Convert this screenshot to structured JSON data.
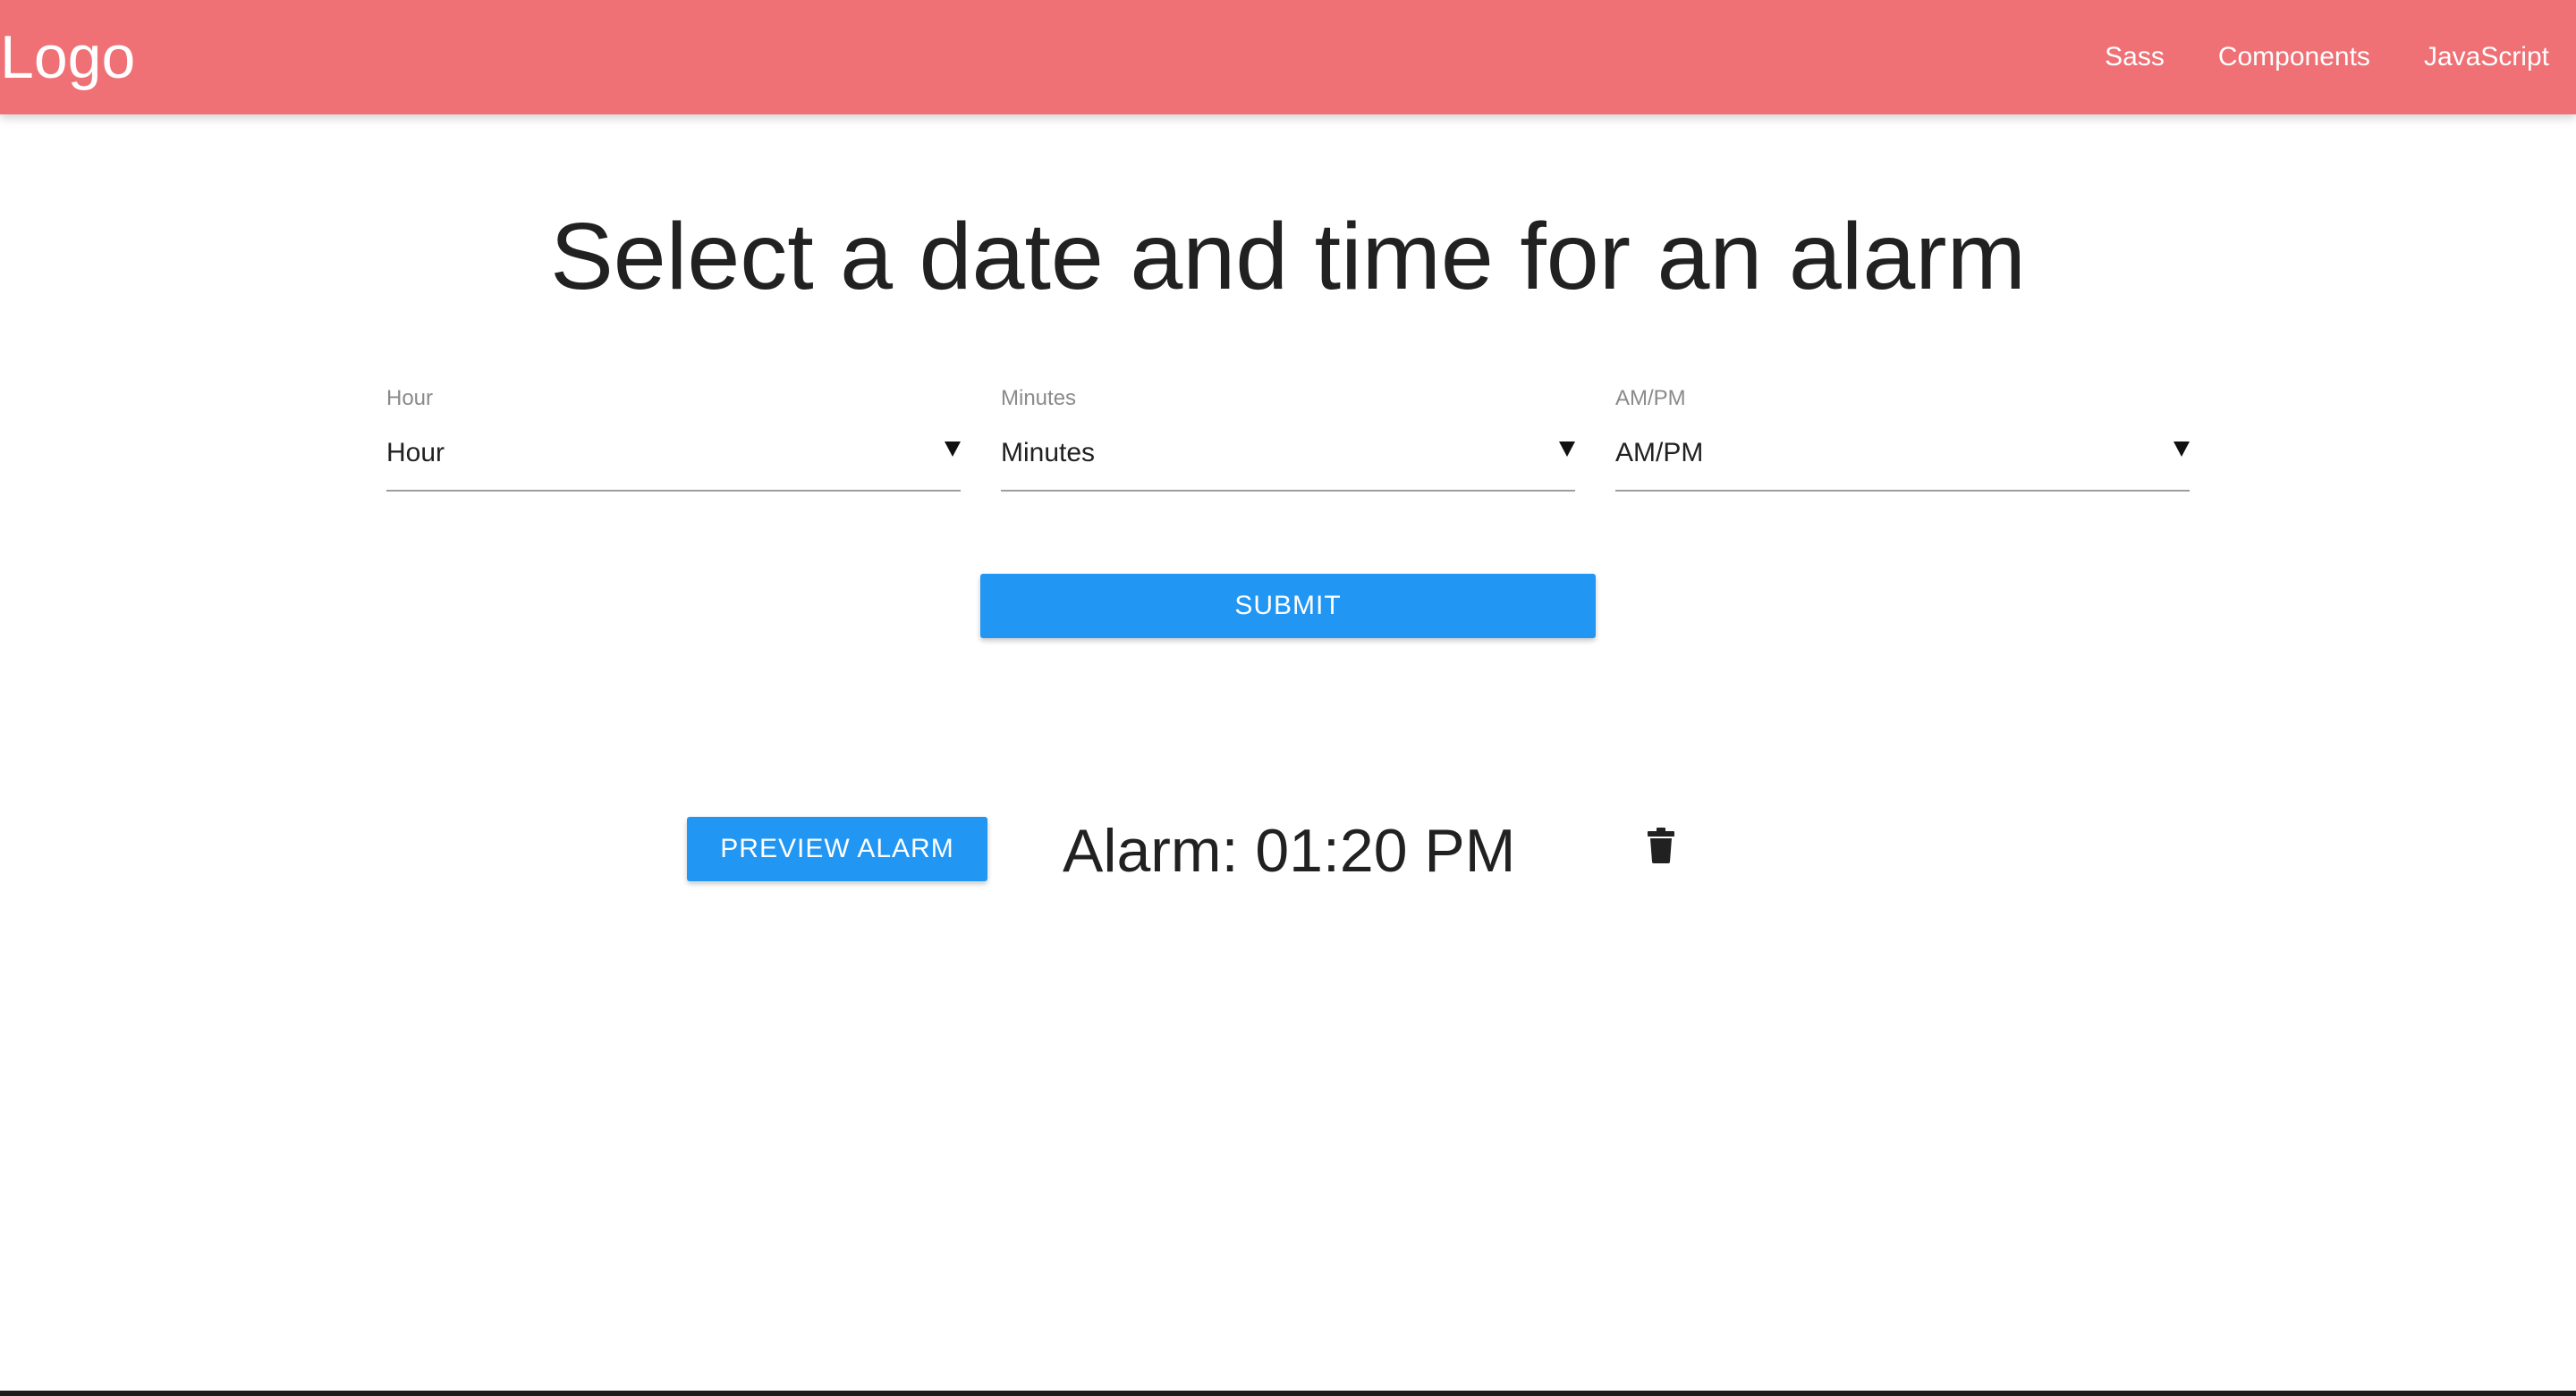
{
  "navbar": {
    "logo": "Logo",
    "links": [
      "Sass",
      "Components",
      "JavaScript"
    ],
    "color": "#ef7075"
  },
  "main": {
    "title": "Select a date and time for an alarm",
    "fields": [
      {
        "label": "Hour",
        "value": "Hour"
      },
      {
        "label": "Minutes",
        "value": "Minutes"
      },
      {
        "label": "AM/PM",
        "value": "AM/PM"
      }
    ],
    "submit_label": "Submit",
    "button_color": "#2196f3"
  },
  "alarm": {
    "preview_label": "Preview Alarm",
    "text": "Alarm: 01:20 PM",
    "delete_icon": "trash-icon"
  }
}
